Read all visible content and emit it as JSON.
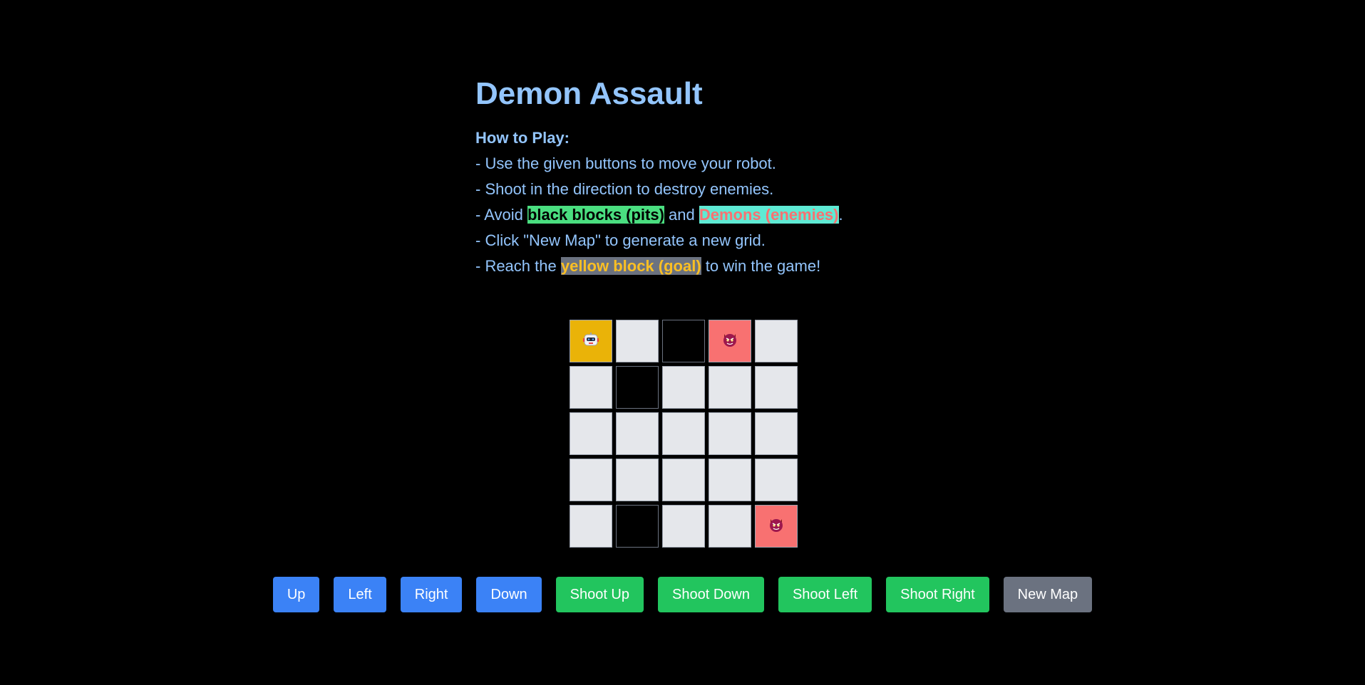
{
  "title": "Demon Assault",
  "instructions": {
    "heading": "How to Play:",
    "line1": "- Use the given buttons to move your robot.",
    "line2": "- Shoot in the direction to destroy enemies.",
    "line3_prefix": "- Avoid ",
    "line3_pits": "black blocks (pits)",
    "line3_mid": " and ",
    "line3_demons": "Demons (enemies)",
    "line3_suffix": ".",
    "line4": "- Click \"New Map\" to generate a new grid.",
    "line5_prefix": "- Reach the ",
    "line5_goal": "yellow block (goal)",
    "line5_suffix": " to win the game!"
  },
  "grid": {
    "rows": 5,
    "cols": 5,
    "cells": [
      [
        "robot",
        "empty",
        "pit",
        "demon",
        "empty"
      ],
      [
        "empty",
        "pit",
        "empty",
        "empty",
        "empty"
      ],
      [
        "empty",
        "empty",
        "empty",
        "empty",
        "empty"
      ],
      [
        "empty",
        "empty",
        "empty",
        "empty",
        "empty"
      ],
      [
        "empty",
        "pit",
        "empty",
        "empty",
        "demon"
      ]
    ]
  },
  "controls": {
    "up": "Up",
    "left": "Left",
    "right": "Right",
    "down": "Down",
    "shoot_up": "Shoot Up",
    "shoot_down": "Shoot Down",
    "shoot_left": "Shoot Left",
    "shoot_right": "Shoot Right",
    "new_map": "New Map"
  },
  "colors": {
    "background": "#000000",
    "text": "#93c5fd",
    "robot_cell": "#eab308",
    "demon_cell": "#f87171",
    "empty_cell": "#e5e7eb",
    "pit_cell": "#000000",
    "move_button": "#3b82f6",
    "shoot_button": "#22c55e",
    "new_map_button": "#6b7280"
  }
}
